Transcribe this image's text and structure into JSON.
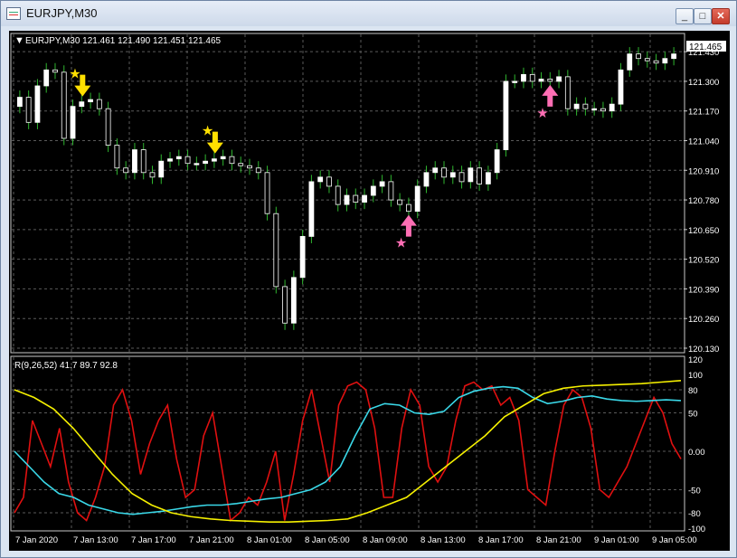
{
  "window": {
    "title": "EURJPY,M30",
    "minimize_glyph": "_",
    "maximize_glyph": "□",
    "close_glyph": "✕"
  },
  "price_panel": {
    "header": "EURJPY,M30  121.461 121.490 121.451 121.465",
    "current_price": "121.465",
    "y_ticks": [
      "121.430",
      "121.300",
      "121.170",
      "121.040",
      "120.910",
      "120.780",
      "120.650",
      "120.520",
      "120.390",
      "120.260",
      "120.130"
    ]
  },
  "indicator_panel": {
    "header": "R(9,26,52) 41.7 89.7 92.8",
    "y_ticks": [
      "120",
      "100",
      "80",
      "50",
      "0.00",
      "-50",
      "-80",
      "-100"
    ]
  },
  "x_axis": {
    "labels": [
      "7 Jan 2020",
      "7 Jan 13:00",
      "7 Jan 17:00",
      "7 Jan 21:00",
      "8 Jan 01:00",
      "8 Jan 05:00",
      "8 Jan 09:00",
      "8 Jan 13:00",
      "8 Jan 17:00",
      "8 Jan 21:00",
      "9 Jan 01:00",
      "9 Jan 05:00"
    ]
  },
  "colors": {
    "bull_candle": "#ffffff",
    "bear_candle": "#ffffff",
    "wick": "#2fb52f",
    "grid": "#5a5a5a",
    "sell_signal": "#ffe000",
    "buy_signal": "#ff6eb4",
    "line_red": "#e01010",
    "line_cyan": "#3ad8e8",
    "line_yellow": "#f5f000"
  },
  "chart_data": [
    {
      "type": "candlestick",
      "symbol": "EURJPY",
      "timeframe": "M30",
      "ylim": [
        120.13,
        121.49
      ],
      "close": [
        121.23,
        121.12,
        121.28,
        121.35,
        121.34,
        121.05,
        121.19,
        121.21,
        121.22,
        121.18,
        121.02,
        120.92,
        120.9,
        121.0,
        120.9,
        120.88,
        120.95,
        120.96,
        120.97,
        120.94,
        120.94,
        120.95,
        120.96,
        120.97,
        120.94,
        120.93,
        120.92,
        120.9,
        120.72,
        120.4,
        120.24,
        120.44,
        120.62,
        120.86,
        120.88,
        120.84,
        120.76,
        120.8,
        120.77,
        120.8,
        120.84,
        120.86,
        120.78,
        120.76,
        120.73,
        120.84,
        120.9,
        120.92,
        120.88,
        120.9,
        120.86,
        120.92,
        120.85,
        120.9,
        121.0,
        121.3,
        121.3,
        121.33,
        121.3,
        121.31,
        121.3,
        121.32,
        121.18,
        121.2,
        121.18,
        121.18,
        121.17,
        121.2,
        121.35,
        121.42,
        121.4,
        121.39,
        121.38,
        121.4,
        121.42
      ],
      "signals": [
        {
          "kind": "sell",
          "bar": 7
        },
        {
          "kind": "sell",
          "bar": 22
        },
        {
          "kind": "buy",
          "bar": 44
        },
        {
          "kind": "buy",
          "bar": 60
        }
      ]
    },
    {
      "type": "line",
      "ylim": [
        -100,
        120
      ],
      "series": [
        {
          "color": "#e01010",
          "values": [
            -80,
            -60,
            40,
            10,
            -20,
            30,
            -40,
            -80,
            -90,
            -60,
            -20,
            60,
            80,
            40,
            -30,
            10,
            40,
            60,
            -10,
            -60,
            -50,
            20,
            50,
            -20,
            -90,
            -80,
            -60,
            -70,
            -40,
            0,
            -90,
            -30,
            40,
            80,
            20,
            -40,
            60,
            85,
            90,
            80,
            30,
            -60,
            -60,
            30,
            80,
            60,
            -20,
            -40,
            -20,
            40,
            85,
            90,
            80,
            85,
            60,
            70,
            40,
            -50,
            -60,
            -70,
            0,
            60,
            80,
            70,
            30,
            -50,
            -60,
            -40,
            -20,
            10,
            40,
            70,
            50,
            10,
            -10
          ]
        },
        {
          "color": "#3ad8e8",
          "values": [
            0,
            -20,
            -40,
            -55,
            -60,
            -70,
            -75,
            -80,
            -82,
            -80,
            -78,
            -75,
            -72,
            -70,
            -70,
            -68,
            -65,
            -62,
            -60,
            -55,
            -50,
            -40,
            -20,
            20,
            55,
            62,
            60,
            50,
            48,
            52,
            70,
            78,
            82,
            84,
            82,
            70,
            62,
            65,
            70,
            72,
            68,
            66,
            65,
            66,
            67,
            66
          ]
        },
        {
          "color": "#f5f000",
          "values": [
            80,
            70,
            55,
            30,
            0,
            -30,
            -55,
            -70,
            -80,
            -85,
            -88,
            -90,
            -91,
            -92,
            -92,
            -91,
            -90,
            -88,
            -80,
            -70,
            -60,
            -40,
            -20,
            0,
            20,
            45,
            60,
            75,
            82,
            85,
            86,
            87,
            88,
            90,
            92
          ]
        }
      ]
    }
  ]
}
